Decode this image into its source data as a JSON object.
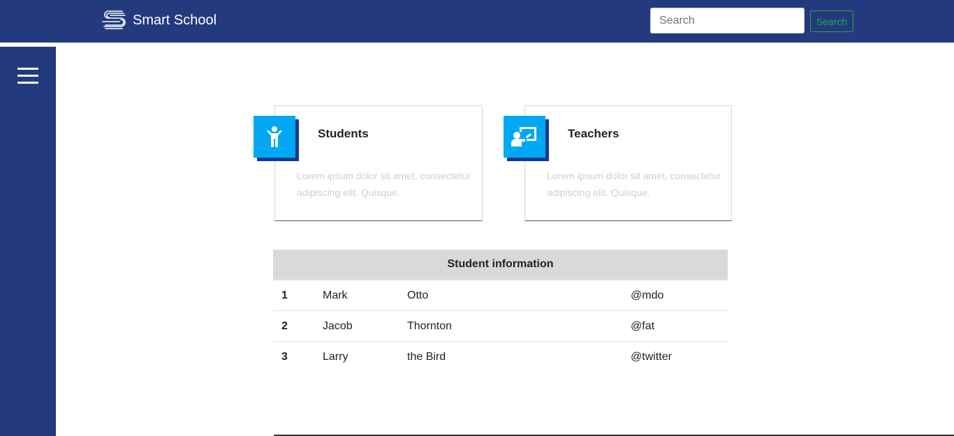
{
  "header": {
    "brand": "Smart School",
    "logo_icon": "stacked-s-logo",
    "search": {
      "placeholder": "Search",
      "value": ""
    },
    "search_button_label": "Search",
    "colors": {
      "background": "#243a7f",
      "search_button": "#28a745"
    }
  },
  "sidebar": {
    "menu_icon": "hamburger-menu-icon",
    "color": "#243a7f"
  },
  "cards": [
    {
      "title": "Students",
      "icon": "child-icon",
      "text": "Lorem ipsum dolor sit amet, consectetur adipiscing elit. Quisque."
    },
    {
      "title": "Teachers",
      "icon": "presentation-icon",
      "text": "Lorem ipsum dolor sit amet, consectetur adipiscing elit. Quisque."
    }
  ],
  "table": {
    "title": "Student information",
    "rows": [
      {
        "num": "1",
        "first": "Mark",
        "last": "Otto",
        "handle": "@mdo"
      },
      {
        "num": "2",
        "first": "Jacob",
        "last": "Thornton",
        "handle": "@fat"
      },
      {
        "num": "3",
        "first": "Larry",
        "last": "the Bird",
        "handle": "@twitter"
      }
    ]
  },
  "accent_color": "#00a8f3"
}
